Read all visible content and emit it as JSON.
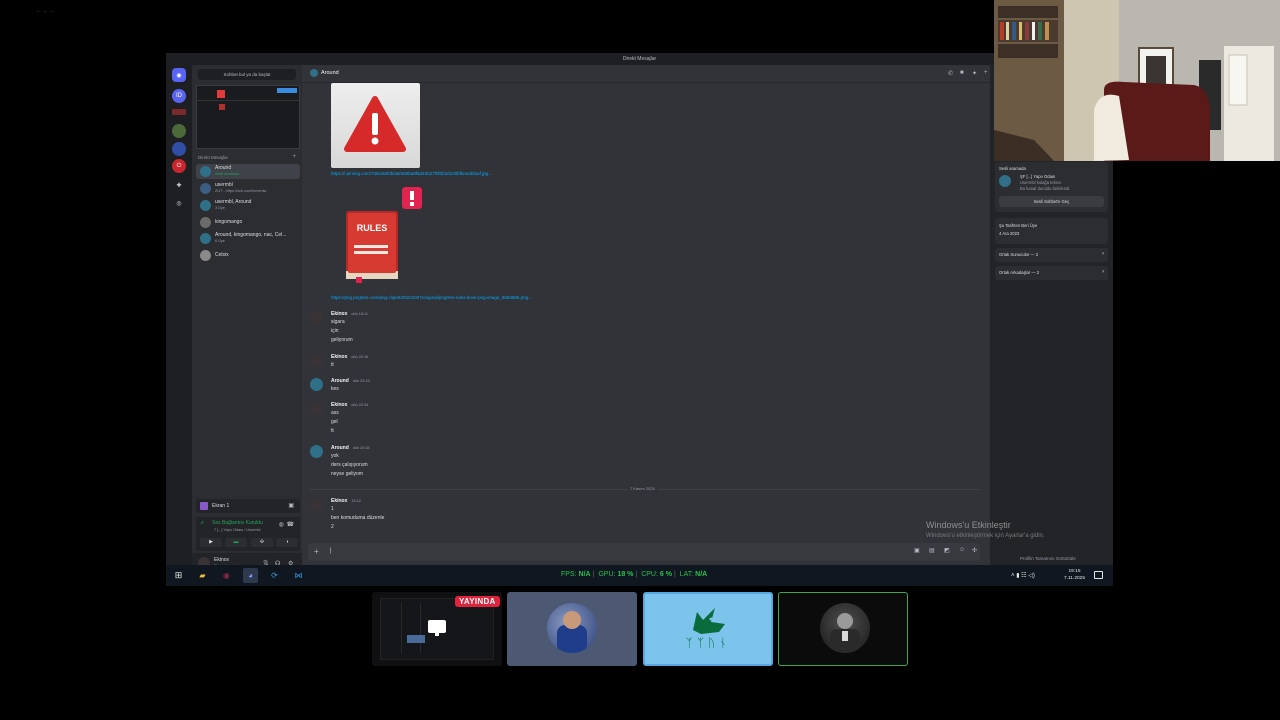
{
  "top_dots": "— — —",
  "window": {
    "title": "Direkt Mesajlar"
  },
  "dm_panel": {
    "search_placeholder": "Sohbet bul ya da başlat",
    "header": "Direkt Mesajlar",
    "items": [
      {
        "name": "Around",
        "sub": "Sesli aramada"
      },
      {
        "name": "usermbl",
        "sub": "ZUT - https://sck.com/fomentw"
      },
      {
        "name": "usermbl, Around",
        "sub": "3 Üye"
      },
      {
        "name": "kingomango",
        "sub": ""
      },
      {
        "name": "Around, kingomango, nac, Cel...",
        "sub": "6 Üye"
      },
      {
        "name": "Celsix",
        "sub": ""
      }
    ],
    "voice_label": "Ekran 1",
    "voice_status": "Ses Bağlantısı Kuruldu",
    "voice_channel": "7 [...] Yapıı Odası / Usermbl",
    "user": {
      "name": "Ekinox",
      "status": "Ekranın paylaşıyor"
    }
  },
  "chat": {
    "channel": "Around",
    "link1": "https://i.pinimg.com/736x/a6/0b/a8/a60ba8f6d46b27f0f0b2d100bfbea4bfaaf.jpg...",
    "rules_text": "RULES",
    "link2": "https://png.pngtree.com/png-clipart/20221007/original/pngtree-rules-book-png-image_8663686.png...",
    "messages": [
      {
        "author": "Ekinox",
        "time": "dün 18:11",
        "lines": [
          "sigara",
          "için",
          "geliyorum"
        ]
      },
      {
        "author": "Ekinox",
        "time": "dün 20:16",
        "lines": [
          "tt"
        ]
      },
      {
        "author": "Around",
        "time": "dün 20:16",
        "lines": [
          "kes"
        ]
      },
      {
        "author": "Ekinox",
        "time": "dün 20:34",
        "lines": [
          "ass",
          "gel",
          "tt"
        ]
      },
      {
        "author": "Around",
        "time": "dün 20:34",
        "lines": [
          "yok",
          "ders çalışıyorum",
          "neyse geliyom"
        ]
      },
      {
        "author": "Ekinox",
        "time": "19:12",
        "lines": [
          "1",
          "ben komuduma düzenle",
          "2"
        ]
      }
    ],
    "date_divider": "7 Kasım 2025",
    "input_placeholder": "|"
  },
  "profile": {
    "call_title": "Sesli aramada",
    "call_channel": "ŞF [...] Yapıı Odası",
    "call_sub": "Usermbl kulağa tekrar",
    "call_sub2": "Bu kanal duruldu belirlendi",
    "call_button": "Sesli Sohbet'e Geç",
    "member_since_label": "Şu Tarihten Beri Üye",
    "member_since": "4 Ara 2023",
    "mutual_servers": "Ortak Sunucular — 2",
    "mutual_friends": "Ortak Arkadaşlar — 2",
    "view_profile": "Profilin Tamamını Görüntüle"
  },
  "watermark": {
    "line1": "Windows'u Etkinleştir",
    "line2": "Windows'u etkinleştirmek için Ayarlar'a gidin."
  },
  "taskbar": {
    "fps_label": "FPS:",
    "fps_value": "N/A",
    "gpu_label": "GPU:",
    "gpu_value": "18 %",
    "cpu_label": "CPU:",
    "cpu_value": "6 %",
    "lat_label": "LAT:",
    "lat_value": "N/A",
    "time": "19:15",
    "date": "7.11.2025"
  },
  "tiles": {
    "live_badge": "YAYINDA",
    "runes": "ᛉᛉᚢᚾ"
  },
  "colors": {
    "discord_blurple": "#5865f2",
    "online_green": "#23a55a",
    "link_blue": "#00a8fc",
    "live_red": "#e0233c",
    "perf_green": "#29c24c"
  }
}
